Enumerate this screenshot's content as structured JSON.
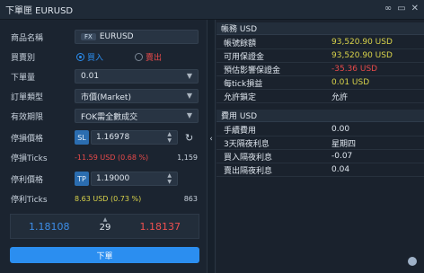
{
  "titlebar": {
    "title": "下單匣 EURUSD"
  },
  "form": {
    "product": {
      "label": "商品名稱",
      "badge": "FX",
      "value": "EURUSD"
    },
    "side": {
      "label": "買賣別",
      "buy": "買入",
      "sell": "賣出"
    },
    "quantity": {
      "label": "下單量",
      "value": "0.01"
    },
    "order_type": {
      "label": "訂單類型",
      "value": "市價(Market)"
    },
    "validity": {
      "label": "有效期限",
      "value": "FOK需全數成交"
    },
    "stop_loss": {
      "label": "停損價格",
      "tag": "SL",
      "value": "1.16978"
    },
    "stop_ticks": {
      "label": "停損Ticks",
      "info": "-11.59 USD (0.68 %)",
      "ticks": "1,159"
    },
    "take_profit": {
      "label": "停利價格",
      "tag": "TP",
      "value": "1.19000"
    },
    "profit_ticks": {
      "label": "停利Ticks",
      "info": "8.63 USD (0.73 %)",
      "ticks": "863"
    },
    "quote": {
      "bid": "1.18108",
      "spread": "29",
      "ask": "1.18137"
    },
    "order_button": "下單"
  },
  "account": {
    "header": "帳務 USD",
    "rows": [
      {
        "label": "帳號餘額",
        "value": "93,520.90 USD"
      },
      {
        "label": "可用保證金",
        "value": "93,520.90 USD"
      },
      {
        "label": "預估影響保證金",
        "value": "-35.36 USD"
      },
      {
        "label": "每tick損益",
        "value": "0.01 USD"
      },
      {
        "label": "允許鎖定",
        "value": "允許"
      }
    ]
  },
  "fees": {
    "header": "費用 USD",
    "rows": [
      {
        "label": "手續費用",
        "value": "0.00"
      },
      {
        "label": "3天隔夜利息",
        "value": "星期四"
      },
      {
        "label": "買入隔夜利息",
        "value": "-0.07"
      },
      {
        "label": "賣出隔夜利息",
        "value": "0.04"
      }
    ]
  },
  "colors": {
    "accent": "#2b8ef0",
    "bid": "#3d8ee8",
    "ask": "#ef5050",
    "positive": "#d9d34a",
    "negative": "#e84a4a"
  }
}
